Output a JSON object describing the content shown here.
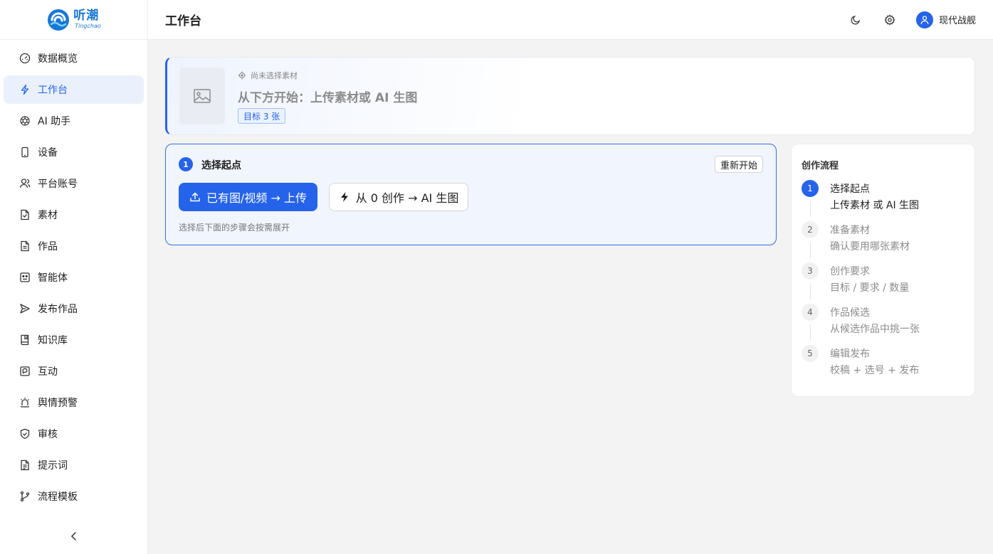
{
  "app": {
    "name_cn": "听潮",
    "name_en": "Tingchao",
    "brand_color": "#1677d9",
    "accent_color": "#2563eb"
  },
  "sidebar": {
    "items": [
      {
        "label": "数据概览",
        "icon": "dashboard-icon"
      },
      {
        "label": "工作台",
        "icon": "lightning-icon",
        "active": true
      },
      {
        "label": "AI 助手",
        "icon": "openai-icon"
      },
      {
        "label": "设备",
        "icon": "phone-icon"
      },
      {
        "label": "平台账号",
        "icon": "users-icon"
      },
      {
        "label": "素材",
        "icon": "file-icon"
      },
      {
        "label": "作品",
        "icon": "file-text-icon"
      },
      {
        "label": "智能体",
        "icon": "robot-icon"
      },
      {
        "label": "发布作品",
        "icon": "send-icon"
      },
      {
        "label": "知识库",
        "icon": "book-icon"
      },
      {
        "label": "互动",
        "icon": "message-icon"
      },
      {
        "label": "舆情预警",
        "icon": "alarm-icon"
      },
      {
        "label": "审核",
        "icon": "shield-check-icon"
      },
      {
        "label": "提示词",
        "icon": "document-icon"
      },
      {
        "label": "流程模板",
        "icon": "git-branch-icon"
      }
    ],
    "collapse_icon": "chevron-left-icon"
  },
  "header": {
    "title": "工作台",
    "theme_icon": "moon-icon",
    "settings_icon": "gear-icon",
    "user_name": "现代战舰"
  },
  "banner": {
    "status": "尚未选择素材",
    "title": "从下方开始：上传素材或 AI 生图",
    "badge": "目标 3 张"
  },
  "step_card": {
    "number": "1",
    "title": "选择起点",
    "restart_label": "重新开始",
    "upload_label": "已有图/视频 → 上传",
    "generate_label": "从 0 创作 → AI 生图",
    "hint": "选择后下面的步骤会按需展开"
  },
  "flow": {
    "title": "创作流程",
    "steps": [
      {
        "num": "1",
        "name": "选择起点",
        "desc": "上传素材 或 AI 生图",
        "active": true
      },
      {
        "num": "2",
        "name": "准备素材",
        "desc": "确认要用哪张素材"
      },
      {
        "num": "3",
        "name": "创作要求",
        "desc": "目标 / 要求 / 数量"
      },
      {
        "num": "4",
        "name": "作品候选",
        "desc": "从候选作品中挑一张"
      },
      {
        "num": "5",
        "name": "编辑发布",
        "desc": "校稿 + 选号 + 发布"
      }
    ]
  }
}
